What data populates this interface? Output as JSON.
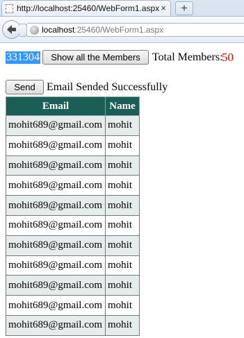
{
  "browser": {
    "tab_title": "http://localhost:25460/WebForm1.aspx",
    "tab_close": "×",
    "new_tab": "+",
    "url_host": "localhost",
    "url_rest": ":25460/WebForm1.aspx"
  },
  "toolbar": {
    "selected_code": "331304",
    "show_members_label": "Show all the Members",
    "total_label": "Total Members:",
    "total_count": "50"
  },
  "send": {
    "send_label": "Send",
    "status_message": "Email Sended Successfully"
  },
  "table": {
    "headers": [
      "Email",
      "Name"
    ],
    "rows": [
      {
        "email": "mohit689@gmail.com",
        "name": "mohit"
      },
      {
        "email": "mohit689@gmail.com",
        "name": "mohit"
      },
      {
        "email": "mohit689@gmail.com",
        "name": "mohit"
      },
      {
        "email": "mohit689@gmail.com",
        "name": "mohit"
      },
      {
        "email": "mohit689@gmail.com",
        "name": "mohit"
      },
      {
        "email": "mohit689@gmail.com",
        "name": "mohit"
      },
      {
        "email": "mohit689@gmail.com",
        "name": "mohit"
      },
      {
        "email": "mohit689@gmail.com",
        "name": "mohit"
      },
      {
        "email": "mohit689@gmail.com",
        "name": "mohit"
      },
      {
        "email": "mohit689@gmail.com",
        "name": "mohit"
      },
      {
        "email": "mohit689@gmail.com",
        "name": "mohit"
      }
    ]
  },
  "colors": {
    "header_bg": "#1b5e56",
    "alt_row_bg": "#e6ecec",
    "count_color": "#e00000",
    "selection_bg": "#3399ff"
  }
}
